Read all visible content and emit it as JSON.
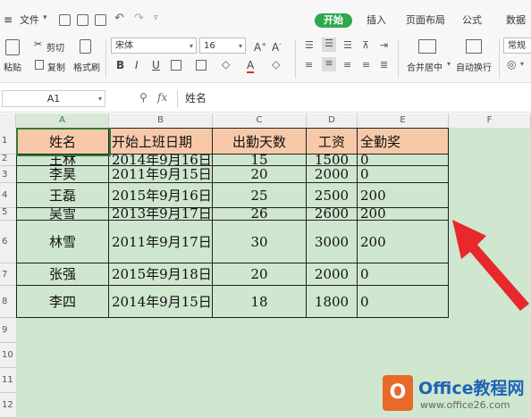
{
  "menubar": {
    "file_label": "文件",
    "tabs": [
      "开始",
      "插入",
      "页面布局",
      "公式",
      "数据"
    ]
  },
  "ribbon": {
    "paste": "粘贴",
    "cut": "剪切",
    "copy": "复制",
    "format_painter": "格式刷",
    "font_name": "宋体",
    "font_size": "16",
    "merge_center": "合并居中",
    "auto_wrap": "自动换行",
    "number_format": "常规"
  },
  "formula_bar": {
    "cell_ref": "A1",
    "fx": "fx",
    "content": "姓名"
  },
  "sheet": {
    "columns": [
      "A",
      "B",
      "C",
      "D",
      "E",
      "F"
    ],
    "rows": [
      "1",
      "2",
      "3",
      "4",
      "5",
      "6",
      "7",
      "8",
      "9",
      "10",
      "11",
      "12"
    ],
    "table": [
      [
        "姓名",
        "开始上班日期",
        "出勤天数",
        "工资",
        "全勤奖"
      ],
      [
        "王林",
        "2014年9月16日",
        "15",
        "1500",
        "0"
      ],
      [
        "李昊",
        "2011年9月15日",
        "20",
        "2000",
        "0"
      ],
      [
        "王磊",
        "2015年9月16日",
        "25",
        "2500",
        "200"
      ],
      [
        "吴雪",
        "2013年9月17日",
        "26",
        "2600",
        "200"
      ],
      [
        "林雪",
        "2011年9月17日",
        "30",
        "3000",
        "200"
      ],
      [
        "张强",
        "2015年9月18日",
        "20",
        "2000",
        "0"
      ],
      [
        "李四",
        "2014年9月15日",
        "18",
        "1800",
        "0"
      ]
    ]
  },
  "watermark": {
    "brand": "Office教程网",
    "url": "www.office26.com"
  },
  "colors": {
    "accent_green": "#2fa84f",
    "header_fill": "#f8c9a9",
    "sheet_bg": "#cfe6cf",
    "arrow": "#e8282c",
    "logo_orange": "#e8692a"
  }
}
